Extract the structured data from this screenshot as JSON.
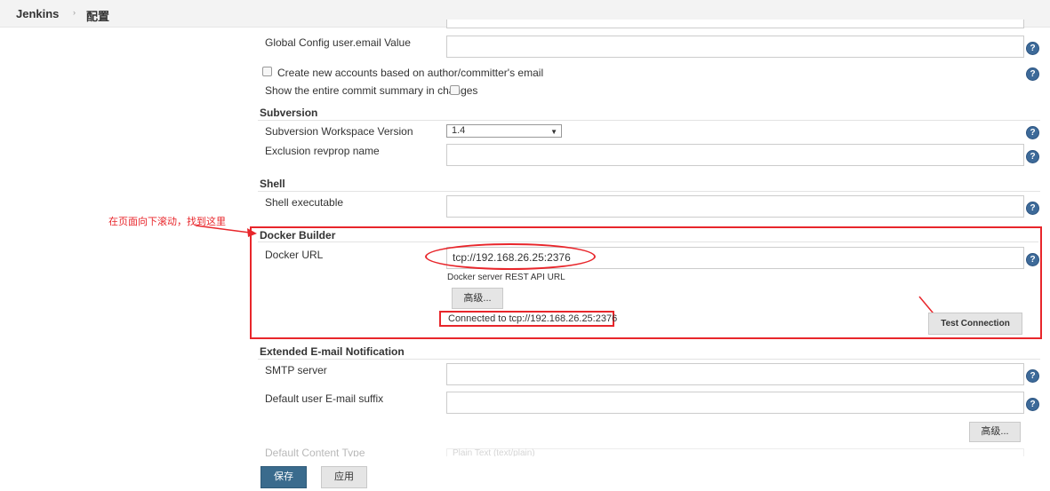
{
  "header": {
    "brand": "Jenkins",
    "separator": "›",
    "breadcrumb": "配置"
  },
  "git": {
    "email_label": "Global Config user.email Value",
    "email_value": "",
    "create_accounts_label": "Create new accounts based on author/committer's email",
    "show_summary_label": "Show the entire commit summary in changes"
  },
  "subversion": {
    "title": "Subversion",
    "workspace_label": "Subversion Workspace Version",
    "workspace_value": "1.4",
    "exclusion_label": "Exclusion revprop name",
    "exclusion_value": ""
  },
  "shell": {
    "title": "Shell",
    "executable_label": "Shell executable",
    "executable_value": ""
  },
  "annotation": {
    "note": "在页面向下滚动，找到这里"
  },
  "docker": {
    "title": "Docker Builder",
    "url_label": "Docker URL",
    "url_value": "tcp://192.168.26.25:2376",
    "url_hint": "Docker server REST API URL",
    "advanced_label": "高级...",
    "status": "Connected to tcp://192.168.26.25:2376",
    "test_label": "Test Connection"
  },
  "email_ext": {
    "title": "Extended E-mail Notification",
    "smtp_label": "SMTP server",
    "smtp_value": "",
    "suffix_label": "Default user E-mail suffix",
    "suffix_value": "",
    "advanced_label": "高级...",
    "content_type_label": "Default Content Type",
    "content_type_value": "Plain Text (text/plain)"
  },
  "footer": {
    "save_label": "保存",
    "apply_label": "应用"
  },
  "icons": {
    "help": "help-icon",
    "dropdown": "chevron-down-icon"
  },
  "colors": {
    "accent": "#3a6b8d",
    "annotation": "#e8262b",
    "help": "#3d6a99"
  }
}
